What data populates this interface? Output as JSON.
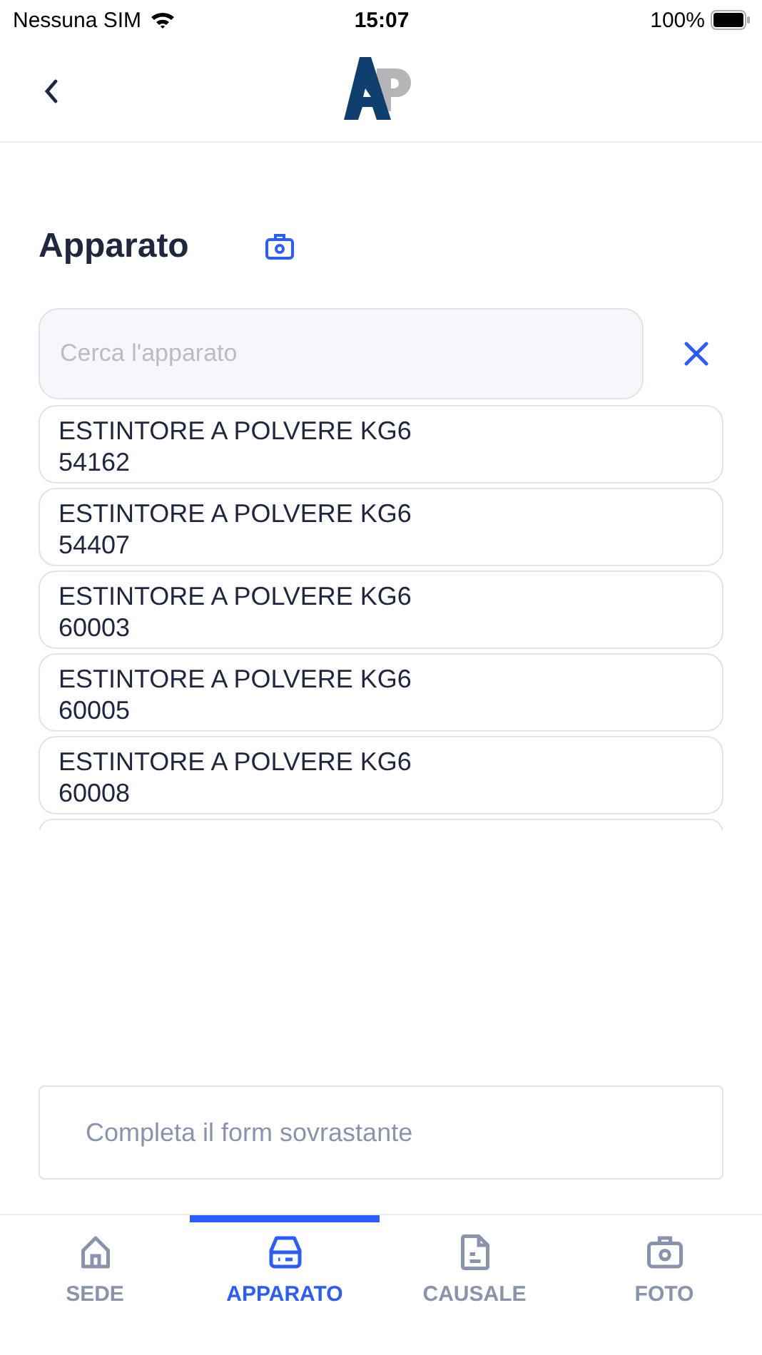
{
  "status_bar": {
    "carrier": "Nessuna SIM",
    "time": "15:07",
    "battery": "100%"
  },
  "section": {
    "title": "Apparato"
  },
  "search": {
    "placeholder": "Cerca l'apparato"
  },
  "items": [
    {
      "name": "ESTINTORE A POLVERE KG6",
      "code": "54162"
    },
    {
      "name": "ESTINTORE A POLVERE KG6",
      "code": "54407"
    },
    {
      "name": "ESTINTORE A POLVERE KG6",
      "code": "60003"
    },
    {
      "name": "ESTINTORE A POLVERE KG6",
      "code": "60005"
    },
    {
      "name": "ESTINTORE A POLVERE KG6",
      "code": "60008"
    }
  ],
  "notice": "Completa il form sovrastante",
  "tabs": [
    {
      "label": "SEDE",
      "kind": "home",
      "selected": false
    },
    {
      "label": "APPARATO",
      "kind": "drive",
      "selected": true
    },
    {
      "label": "CAUSALE",
      "kind": "document",
      "selected": false
    },
    {
      "label": "FOTO",
      "kind": "camera",
      "selected": false
    }
  ]
}
